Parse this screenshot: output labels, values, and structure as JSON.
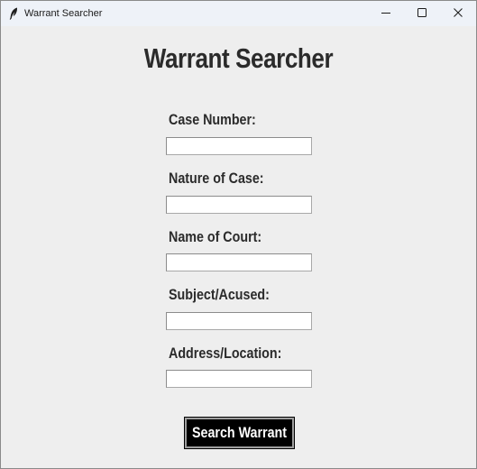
{
  "window": {
    "title": "Warrant Searcher",
    "icon": "feather-icon",
    "controls": [
      "minimize-icon",
      "maximize-icon",
      "close-icon"
    ]
  },
  "form": {
    "heading": "Warrant Searcher",
    "fields": [
      {
        "label": "Case Number:",
        "value": "",
        "placeholder": ""
      },
      {
        "label": "Nature of Case:",
        "value": "",
        "placeholder": ""
      },
      {
        "label": "Name of Court:",
        "value": "",
        "placeholder": ""
      },
      {
        "label": "Subject/Acused:",
        "value": "",
        "placeholder": ""
      },
      {
        "label": "Address/Location:",
        "value": "",
        "placeholder": ""
      }
    ],
    "submit_label": "Search Warrant"
  },
  "colors": {
    "background": "#eeeeee",
    "titlebar": "#eef2f8",
    "text": "#2b2b2b",
    "button_bg": "#000000",
    "button_text": "#ffffff"
  }
}
